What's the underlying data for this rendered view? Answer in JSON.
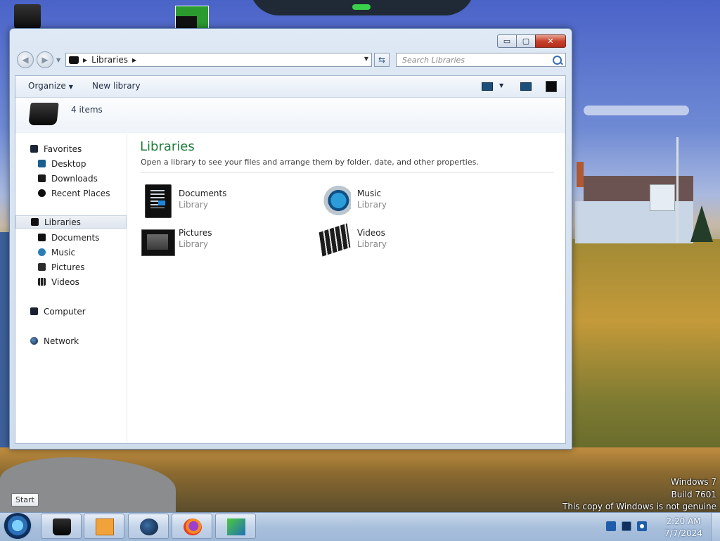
{
  "window": {
    "address_path": "Libraries",
    "search_placeholder": "Search Libraries",
    "caption": {
      "minimize": "▭",
      "maximize": "▢",
      "close": "✕"
    }
  },
  "toolbar": {
    "organize_label": "Organize",
    "new_library_label": "New library"
  },
  "header": {
    "item_count": "4 items"
  },
  "sidebar": {
    "favorites": "Favorites",
    "favorites_items": [
      {
        "label": "Desktop",
        "icon": "desktop-icon"
      },
      {
        "label": "Downloads",
        "icon": "downloads-icon"
      },
      {
        "label": "Recent Places",
        "icon": "recent-places-icon"
      }
    ],
    "libraries": "Libraries",
    "libraries_items": [
      {
        "label": "Documents",
        "icon": "documents-icon"
      },
      {
        "label": "Music",
        "icon": "music-icon"
      },
      {
        "label": "Pictures",
        "icon": "pictures-icon"
      },
      {
        "label": "Videos",
        "icon": "videos-icon"
      }
    ],
    "computer": "Computer",
    "network": "Network"
  },
  "main": {
    "title": "Libraries",
    "description": "Open a library to see your files and arrange them by folder, date, and other properties.",
    "libraries": [
      {
        "name": "Documents",
        "type": "Library",
        "icon": "documents-library-icon"
      },
      {
        "name": "Music",
        "type": "Library",
        "icon": "music-library-icon"
      },
      {
        "name": "Pictures",
        "type": "Library",
        "icon": "pictures-library-icon"
      },
      {
        "name": "Videos",
        "type": "Library",
        "icon": "videos-library-icon"
      }
    ]
  },
  "taskbar": {
    "start_tooltip": "Start",
    "pinned": [
      "windows-explorer-icon",
      "media-player-icon",
      "globe-icon",
      "firefox-icon",
      "app-icon"
    ],
    "clock_time": "2:20 AM",
    "clock_date": "7/7/2024"
  },
  "watermark": {
    "line1": "Windows 7",
    "line2": "Build 7601",
    "line3": "This copy of Windows is not genuine"
  },
  "colors": {
    "title_accent": "#1f7a3a",
    "taskbar": "#a9c0dc",
    "window_frame": "#cfdcec"
  }
}
